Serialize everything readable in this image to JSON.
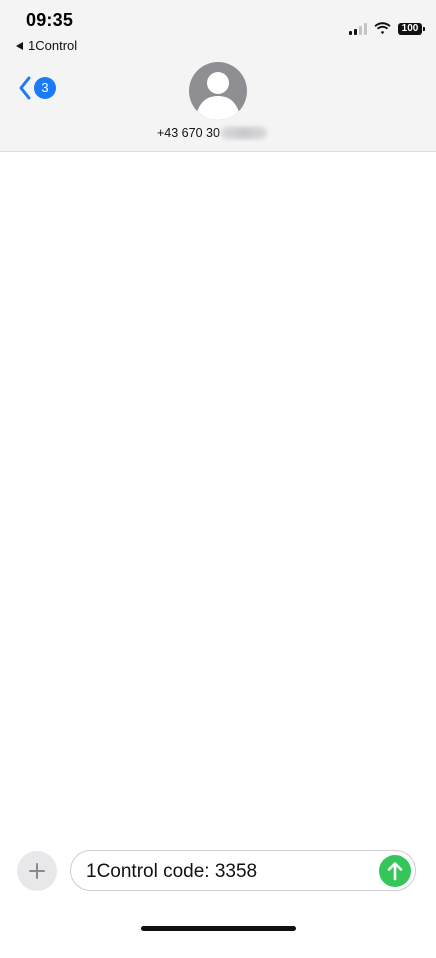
{
  "status_bar": {
    "time": "09:35",
    "back_app": "1Control",
    "battery": "100",
    "signal_icon": "cellular-signal-icon",
    "wifi_icon": "wifi-icon"
  },
  "header": {
    "back_badge": "3",
    "back_icon": "chevron-left-icon",
    "avatar_icon": "person-avatar-icon",
    "contact": "+43 670 30"
  },
  "composer": {
    "plus_icon": "plus-icon",
    "draft_text": "1Control code: 3358",
    "send_icon": "arrow-up-icon"
  },
  "colors": {
    "accent_blue": "#1a7cf5",
    "send_green": "#35c659",
    "header_bg": "#f4f4f5",
    "avatar_gray": "#8e8e93"
  }
}
